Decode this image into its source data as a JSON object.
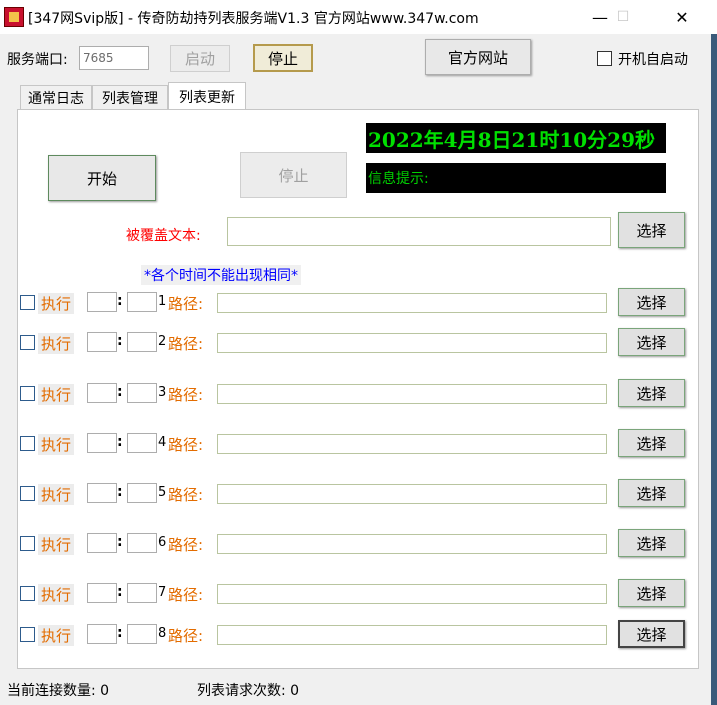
{
  "window": {
    "title": "[347网Svip版] - 传奇防劫持列表服务端V1.3 官方网站www.347w.com",
    "minimize": "—",
    "maximize": "☐",
    "close": "✕"
  },
  "toolbar": {
    "port_label": "服务端口:",
    "port_value": "7685",
    "start_label": "启动",
    "stop_label": "停止",
    "website_label": "官方网站",
    "autostart_label": "开机自启动"
  },
  "tabs": [
    {
      "label": "通常日志"
    },
    {
      "label": "列表管理"
    },
    {
      "label": "列表更新",
      "active": true
    }
  ],
  "panel": {
    "start_button": "开始",
    "stop_button": "停止",
    "datetime": "2022年4月8日21时10分29秒",
    "info_label": "信息提示:",
    "cover_text_label": "被覆盖文本:",
    "cover_text_value": "",
    "select_label": "选择",
    "notice": "*各个时间不能出现相同*",
    "rows": [
      {
        "exec": "执行",
        "sep": ":",
        "index": "1",
        "path_label": "路径:",
        "select": "选择"
      },
      {
        "exec": "执行",
        "sep": ":",
        "index": "2",
        "path_label": "路径:",
        "select": "选择"
      },
      {
        "exec": "执行",
        "sep": ":",
        "index": "3",
        "path_label": "路径:",
        "select": "选择"
      },
      {
        "exec": "执行",
        "sep": ":",
        "index": "4",
        "path_label": "路径:",
        "select": "选择"
      },
      {
        "exec": "执行",
        "sep": ":",
        "index": "5",
        "path_label": "路径:",
        "select": "选择"
      },
      {
        "exec": "执行",
        "sep": ":",
        "index": "6",
        "path_label": "路径:",
        "select": "选择"
      },
      {
        "exec": "执行",
        "sep": ":",
        "index": "7",
        "path_label": "路径:",
        "select": "选择"
      },
      {
        "exec": "执行",
        "sep": ":",
        "index": "8",
        "path_label": "路径:",
        "select": "选择"
      }
    ]
  },
  "status": {
    "connections_label": "当前连接数量: 0",
    "requests_label": "列表请求次数: 0"
  },
  "colors": {
    "datetime_text": "#00e000",
    "label_red": "#ff0000",
    "label_blue": "#0000ff",
    "label_orange": "#e36c00"
  }
}
